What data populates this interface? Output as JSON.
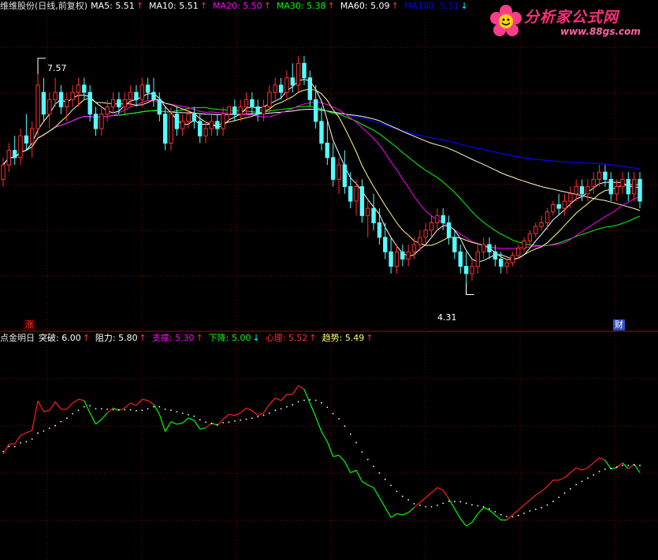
{
  "main_header": {
    "title": "维维股份(日线,前复权)",
    "items": [
      {
        "label": "MA5:",
        "value": "5.51",
        "color": "#ffffff",
        "arrow": "↑",
        "arrow_color": "#ff3030"
      },
      {
        "label": "MA10:",
        "value": "5.51",
        "color": "#ffffff",
        "arrow": "↑",
        "arrow_color": "#ff3030"
      },
      {
        "label": "MA20:",
        "value": "5.50",
        "color": "#ff00ff",
        "arrow": "↑",
        "arrow_color": "#ff3030"
      },
      {
        "label": "MA30:",
        "value": "5.38",
        "color": "#00ff00",
        "arrow": "↑",
        "arrow_color": "#ff3030"
      },
      {
        "label": "MA60:",
        "value": "5.09",
        "color": "#ffffff",
        "arrow": "↑",
        "arrow_color": "#ff3030"
      },
      {
        "label": "MA100:",
        "value": "5.51",
        "color": "#0000ff",
        "arrow": "↓",
        "arrow_color": "#00ffff"
      }
    ]
  },
  "lower_header": {
    "title": "点金明日",
    "items": [
      {
        "label": "突破:",
        "value": "6.00",
        "color": "#ffffff",
        "arrow": "↑",
        "arrow_color": "#ff3030"
      },
      {
        "label": "阻力:",
        "value": "5.80",
        "color": "#ffffff",
        "arrow": "↑",
        "arrow_color": "#ff3030"
      },
      {
        "label": "支撑:",
        "value": "5.30",
        "color": "#ff00ff",
        "arrow": "↑",
        "arrow_color": "#ff3030"
      },
      {
        "label": "下降:",
        "value": "5.00",
        "color": "#00ff00",
        "arrow": "↓",
        "arrow_color": "#00ffff"
      },
      {
        "label": "心理:",
        "value": "5.52",
        "color": "#ff3030",
        "arrow": "↑",
        "arrow_color": "#ff3030"
      },
      {
        "label": "趋势:",
        "value": "5.49",
        "color": "#ffff66",
        "arrow": "↑",
        "arrow_color": "#ff3030"
      }
    ]
  },
  "annotations": {
    "high_label": "7.57",
    "low_label": "4.31",
    "zhang_marker": "涨",
    "cai_marker": "财"
  },
  "watermark": {
    "text": "分析家公式网",
    "url": "www.88gs.com"
  },
  "colors": {
    "up": "#ff3030",
    "down": "#54ffff",
    "ma5": "#ffffff",
    "ma10": "#ffff88",
    "ma20": "#ff00ff",
    "ma30": "#00ff00",
    "ma60": "#ffffcc",
    "ma100": "#0000ff",
    "grid": "#8b0000"
  },
  "chart_data": [
    {
      "type": "candlestick",
      "title": "维维股份(日线,前复权)",
      "ylim": [
        4.0,
        8.2
      ],
      "high_marker": 7.57,
      "low_marker": 4.31,
      "series": [
        {
          "name": "MA5",
          "values": "moving-average"
        },
        {
          "name": "MA10",
          "values": "moving-average"
        },
        {
          "name": "MA20",
          "values": "moving-average"
        },
        {
          "name": "MA30",
          "values": "moving-average"
        },
        {
          "name": "MA60",
          "values": "moving-average"
        },
        {
          "name": "MA100",
          "values": "moving-average"
        }
      ],
      "candles": [
        [
          5.9,
          6.2,
          5.8,
          6.1
        ],
        [
          6.1,
          6.4,
          6.0,
          6.3
        ],
        [
          6.3,
          6.5,
          6.1,
          6.2
        ],
        [
          6.2,
          6.6,
          6.1,
          6.5
        ],
        [
          6.5,
          6.8,
          6.3,
          6.4
        ],
        [
          6.4,
          6.7,
          6.2,
          6.6
        ],
        [
          6.6,
          7.57,
          6.5,
          7.2
        ],
        [
          7.1,
          7.3,
          6.7,
          6.8
        ],
        [
          6.8,
          7.1,
          6.6,
          7.0
        ],
        [
          7.0,
          7.3,
          6.9,
          7.1
        ],
        [
          7.1,
          7.2,
          6.8,
          6.9
        ],
        [
          6.9,
          7.1,
          6.7,
          7.0
        ],
        [
          7.0,
          7.2,
          6.9,
          7.1
        ],
        [
          7.1,
          7.3,
          6.9,
          7.2
        ],
        [
          7.2,
          7.3,
          7.0,
          7.1
        ],
        [
          7.1,
          7.2,
          6.7,
          6.8
        ],
        [
          6.8,
          6.9,
          6.5,
          6.6
        ],
        [
          6.6,
          6.9,
          6.5,
          6.8
        ],
        [
          6.8,
          7.0,
          6.7,
          6.9
        ],
        [
          6.9,
          7.1,
          6.8,
          7.0
        ],
        [
          7.0,
          7.1,
          6.8,
          6.9
        ],
        [
          6.9,
          7.1,
          6.8,
          7.0
        ],
        [
          7.0,
          7.2,
          6.9,
          7.1
        ],
        [
          7.1,
          7.2,
          6.9,
          7.0
        ],
        [
          7.0,
          7.3,
          6.9,
          7.2
        ],
        [
          7.2,
          7.3,
          7.0,
          7.1
        ],
        [
          7.1,
          7.3,
          6.9,
          7.0
        ],
        [
          7.0,
          7.1,
          6.7,
          6.8
        ],
        [
          6.8,
          6.9,
          6.3,
          6.4
        ],
        [
          6.4,
          6.9,
          6.3,
          6.8
        ],
        [
          6.8,
          6.9,
          6.5,
          6.6
        ],
        [
          6.6,
          6.8,
          6.5,
          6.7
        ],
        [
          6.7,
          6.9,
          6.6,
          6.8
        ],
        [
          6.8,
          6.9,
          6.6,
          6.7
        ],
        [
          6.7,
          6.8,
          6.4,
          6.5
        ],
        [
          6.5,
          6.7,
          6.4,
          6.6
        ],
        [
          6.6,
          6.8,
          6.5,
          6.7
        ],
        [
          6.7,
          6.8,
          6.5,
          6.6
        ],
        [
          6.6,
          6.9,
          6.5,
          6.8
        ],
        [
          6.8,
          6.9,
          6.7,
          6.9
        ],
        [
          6.9,
          7.0,
          6.7,
          6.8
        ],
        [
          6.8,
          7.0,
          6.7,
          6.9
        ],
        [
          6.9,
          7.1,
          6.8,
          7.0
        ],
        [
          7.0,
          7.1,
          6.8,
          6.9
        ],
        [
          6.9,
          7.0,
          6.7,
          6.8
        ],
        [
          6.8,
          7.0,
          6.7,
          6.9
        ],
        [
          6.9,
          7.2,
          6.8,
          7.1
        ],
        [
          7.1,
          7.3,
          7.0,
          7.2
        ],
        [
          7.2,
          7.3,
          7.0,
          7.1
        ],
        [
          7.1,
          7.4,
          7.0,
          7.3
        ],
        [
          7.3,
          7.5,
          7.1,
          7.2
        ],
        [
          7.2,
          7.6,
          7.1,
          7.5
        ],
        [
          7.5,
          7.6,
          7.2,
          7.3
        ],
        [
          7.3,
          7.4,
          6.9,
          7.0
        ],
        [
          7.0,
          7.2,
          6.6,
          6.7
        ],
        [
          6.7,
          6.9,
          6.3,
          6.4
        ],
        [
          6.4,
          6.7,
          6.1,
          6.2
        ],
        [
          6.2,
          6.4,
          5.8,
          5.9
        ],
        [
          5.9,
          6.2,
          5.7,
          6.1
        ],
        [
          6.1,
          6.3,
          5.7,
          5.8
        ],
        [
          5.8,
          6.0,
          5.5,
          5.6
        ],
        [
          5.6,
          5.9,
          5.4,
          5.8
        ],
        [
          5.8,
          5.9,
          5.3,
          5.4
        ],
        [
          5.4,
          5.6,
          5.1,
          5.5
        ],
        [
          5.5,
          5.7,
          5.2,
          5.3
        ],
        [
          5.3,
          5.5,
          5.0,
          5.1
        ],
        [
          5.1,
          5.3,
          4.8,
          4.9
        ],
        [
          4.9,
          5.1,
          4.6,
          4.7
        ],
        [
          4.7,
          5.0,
          4.6,
          4.9
        ],
        [
          4.9,
          5.0,
          4.7,
          4.8
        ],
        [
          4.8,
          5.0,
          4.7,
          4.9
        ],
        [
          4.9,
          5.1,
          4.8,
          5.0
        ],
        [
          5.0,
          5.2,
          4.9,
          5.1
        ],
        [
          5.1,
          5.3,
          5.0,
          5.2
        ],
        [
          5.2,
          5.4,
          5.1,
          5.3
        ],
        [
          5.3,
          5.5,
          5.2,
          5.4
        ],
        [
          5.4,
          5.5,
          5.2,
          5.3
        ],
        [
          5.3,
          5.4,
          5.0,
          5.1
        ],
        [
          5.1,
          5.2,
          4.8,
          4.9
        ],
        [
          4.9,
          5.0,
          4.6,
          4.7
        ],
        [
          4.7,
          4.9,
          4.31,
          4.6
        ],
        [
          4.6,
          4.8,
          4.5,
          4.7
        ],
        [
          4.7,
          5.0,
          4.6,
          4.9
        ],
        [
          4.9,
          5.1,
          4.8,
          5.0
        ],
        [
          5.0,
          5.1,
          4.8,
          4.9
        ],
        [
          4.9,
          5.0,
          4.7,
          4.8
        ],
        [
          4.8,
          4.9,
          4.6,
          4.7
        ],
        [
          4.7,
          4.8,
          4.6,
          4.75
        ],
        [
          4.75,
          4.9,
          4.7,
          4.85
        ],
        [
          4.85,
          5.0,
          4.8,
          4.95
        ],
        [
          4.95,
          5.1,
          4.9,
          5.05
        ],
        [
          5.05,
          5.2,
          5.0,
          5.15
        ],
        [
          5.15,
          5.3,
          5.1,
          5.25
        ],
        [
          5.25,
          5.4,
          5.2,
          5.3
        ],
        [
          5.3,
          5.5,
          5.2,
          5.45
        ],
        [
          5.45,
          5.6,
          5.4,
          5.55
        ],
        [
          5.55,
          5.7,
          5.4,
          5.5
        ],
        [
          5.5,
          5.7,
          5.4,
          5.6
        ],
        [
          5.6,
          5.8,
          5.5,
          5.7
        ],
        [
          5.7,
          5.9,
          5.6,
          5.8
        ],
        [
          5.8,
          5.9,
          5.6,
          5.7
        ],
        [
          5.7,
          5.9,
          5.6,
          5.8
        ],
        [
          5.8,
          6.0,
          5.7,
          5.9
        ],
        [
          5.9,
          6.1,
          5.8,
          6.0
        ],
        [
          6.0,
          6.1,
          5.8,
          5.9
        ],
        [
          5.9,
          6.0,
          5.6,
          5.7
        ],
        [
          5.7,
          5.9,
          5.6,
          5.8
        ],
        [
          5.8,
          6.0,
          5.7,
          5.9
        ],
        [
          5.9,
          6.0,
          5.6,
          5.7
        ],
        [
          5.7,
          6.0,
          5.6,
          5.9
        ],
        [
          5.9,
          6.0,
          5.5,
          5.6
        ]
      ]
    },
    {
      "type": "line",
      "title": "点金明日",
      "ylim": [
        4.0,
        8.2
      ],
      "series": [
        {
          "name": "心理",
          "values": "derived-red-green"
        },
        {
          "name": "趋势",
          "values": "derived-dotted"
        }
      ]
    }
  ]
}
